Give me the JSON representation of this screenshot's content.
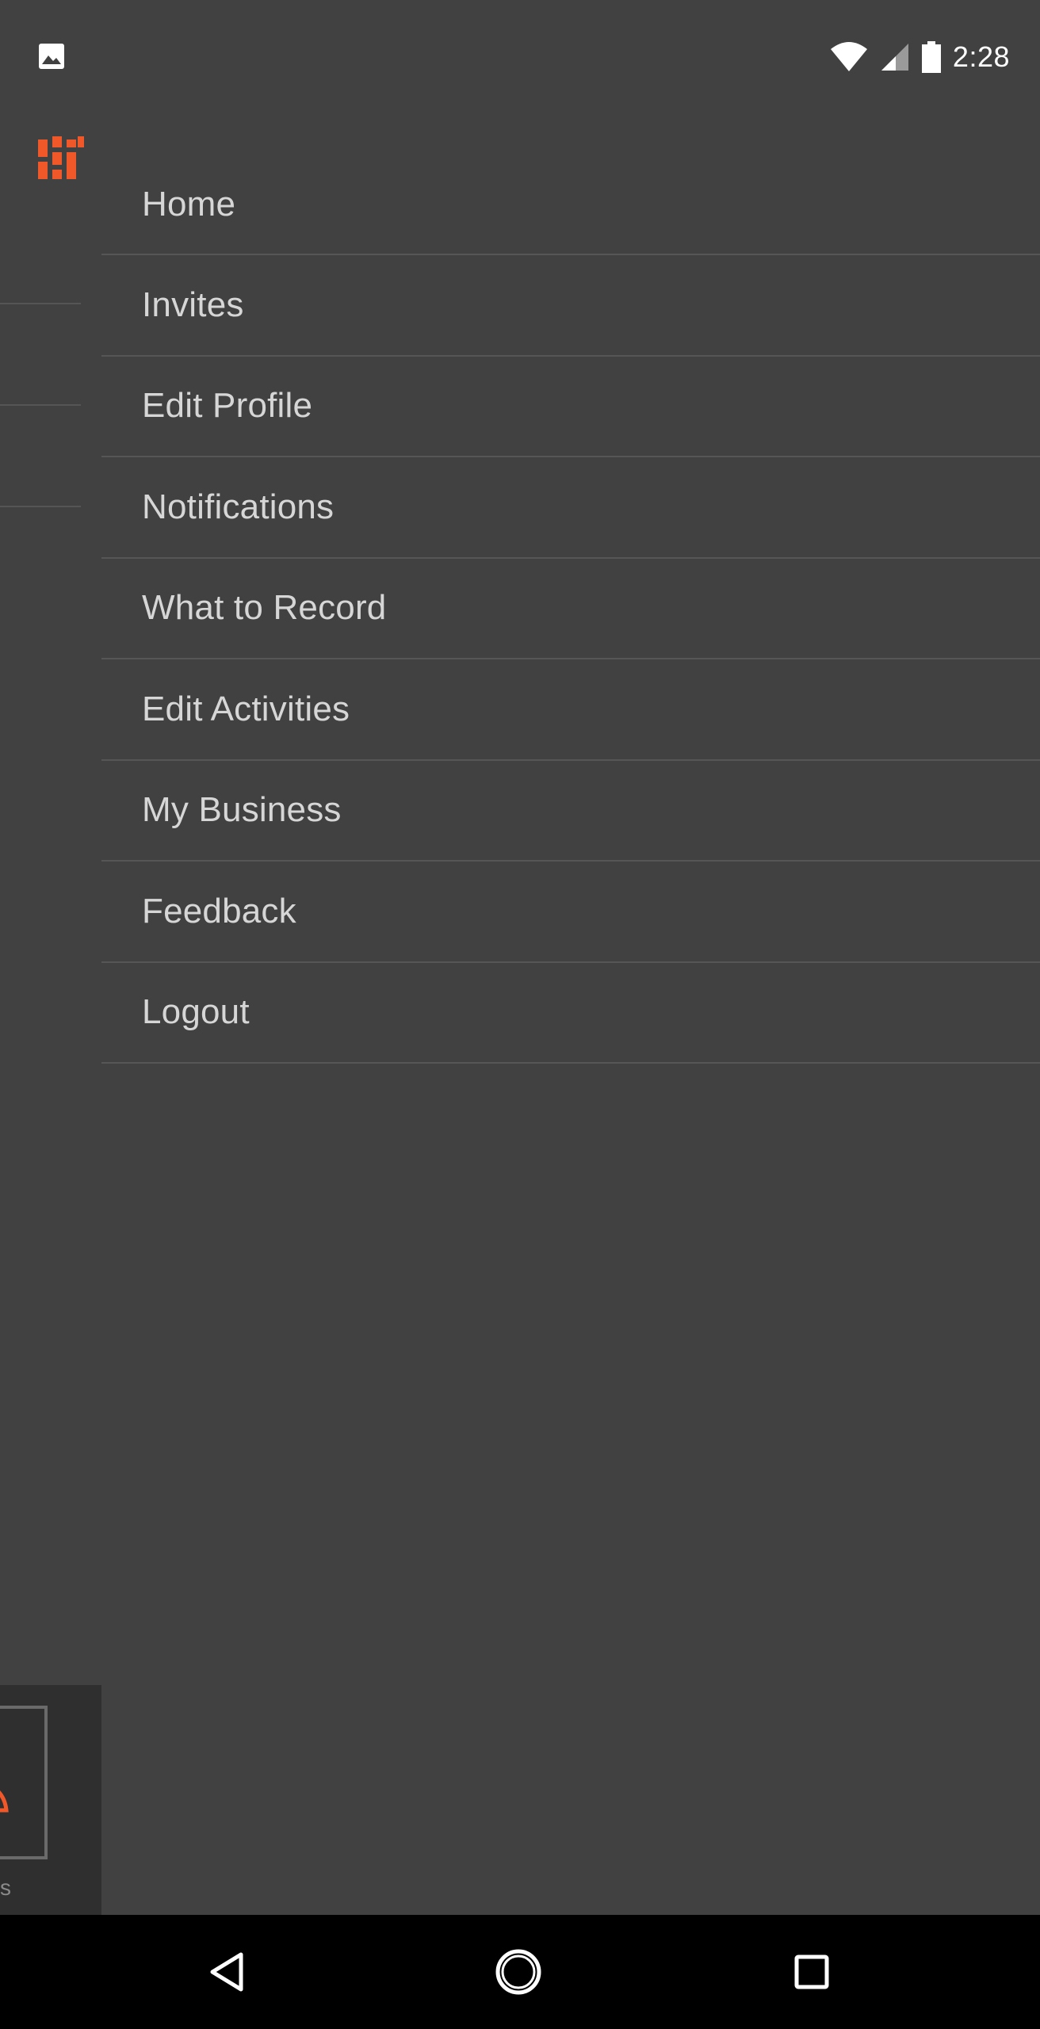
{
  "status_bar": {
    "time": "2:28",
    "icons": [
      "image-notification-icon",
      "wifi-icon",
      "cell-signal-icon",
      "battery-icon"
    ]
  },
  "background_screen": {
    "logo_icon": "app-logo-icon",
    "bottom_label": "s"
  },
  "drawer": {
    "menu_items": [
      {
        "label": "Home"
      },
      {
        "label": "Invites"
      },
      {
        "label": "Edit Profile"
      },
      {
        "label": "Notifications"
      },
      {
        "label": "What to Record"
      },
      {
        "label": "Edit Activities"
      },
      {
        "label": "My Business"
      },
      {
        "label": "Feedback"
      },
      {
        "label": "Logout"
      }
    ]
  },
  "nav_bar": {
    "icons": [
      "back-icon",
      "home-icon",
      "recents-icon"
    ]
  },
  "colors": {
    "background": "#414141",
    "accent": "#f0582a",
    "menu_text": "#d6d6d6",
    "divider": "#565656",
    "nav_bar": "#000000"
  }
}
